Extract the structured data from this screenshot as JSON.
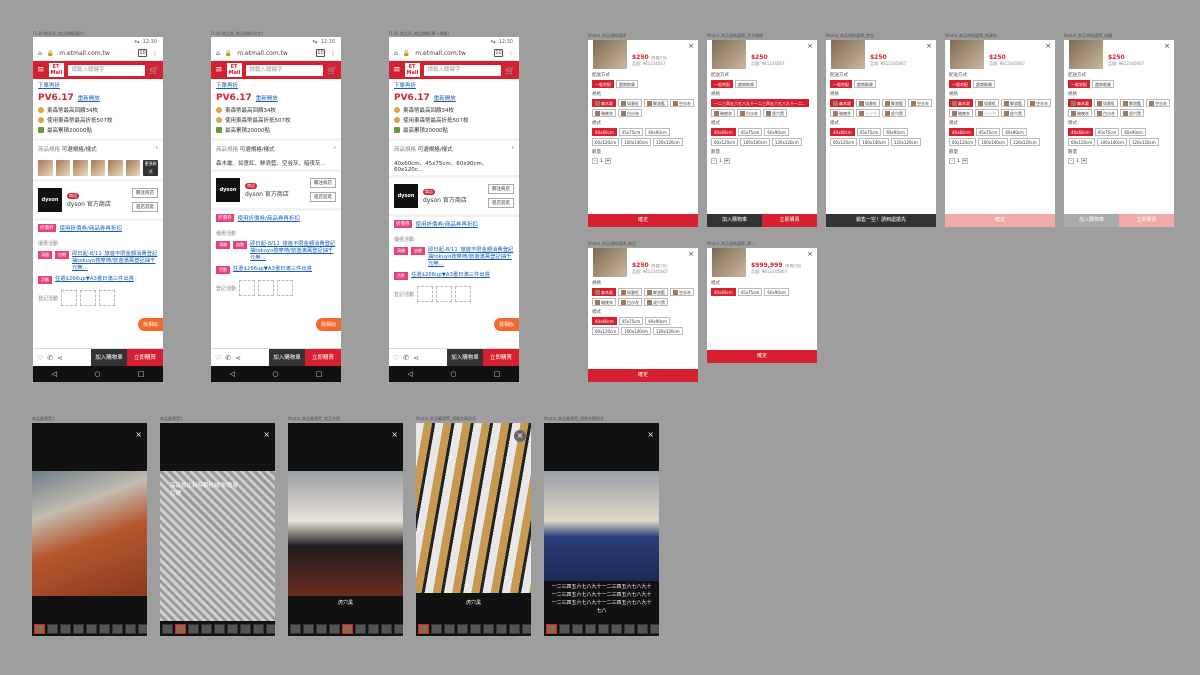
{
  "phones": [
    {
      "caption": "[1-8] 商品頁_商品規格(圖片)",
      "time": "12:30",
      "url": "m.etmall.com.tw",
      "tabs": "10",
      "search": "請輸入關鍵字",
      "logo": "ET Mall",
      "link": "下單再折",
      "pv": "PV6.17",
      "pvlink": "重新開放",
      "row1": "東森幣最高回饋34枚",
      "row2": "使用東森幣最高折抵507枚",
      "row3": "最高累積20000點",
      "spec_label": "商品規格",
      "spec_value": "可選規格/樣式",
      "spec_text": "",
      "more": "更多款式",
      "shop_tag": "商店",
      "shop": "dyson 官方商店",
      "follow": "關注商店",
      "enter": "進店逛逛",
      "promo_tag": "折價券",
      "promo": "使用折價券/商品券再折扣",
      "sec": "優惠活動",
      "e1t": "滿額",
      "e1t2": "加贈",
      "e1": "即日起-8/11_旅遊不限金額消費登記抽tokuyo按摩椅/旅遊滿萬登記抽千元無…",
      "e2t": "活動",
      "e2": "任選$266up▼A3書日滿三件出貨",
      "gift": "登記活動",
      "fab": "找相似",
      "cart": "加入購物車",
      "buy": "立即購買"
    },
    {
      "caption": "[1-8] 商品頁_商品規格(文字)",
      "time": "12:30",
      "url": "m.etmall.com.tw",
      "tabs": "10",
      "search": "請輸入關鍵字",
      "logo": "ET Mall",
      "link": "下單再折",
      "pv": "PV6.17",
      "pvlink": "重新開放",
      "row1": "東森幣最高回饋34枚",
      "row2": "使用東森幣最高折抵507枚",
      "row3": "最高累積20000點",
      "spec_label": "商品規格",
      "spec_value": "可選規格/樣式",
      "spec_text": "森木敢、如意紅、鮮浪藍、空谷灰、暗夜灰...",
      "more": "",
      "shop_tag": "商店",
      "shop": "dyson 官方商店",
      "follow": "關注商店",
      "enter": "進店逛逛",
      "promo_tag": "折價券",
      "promo": "使用折價券/商品券再折扣",
      "sec": "優惠活動",
      "e1t": "滿額",
      "e1t2": "加贈",
      "e1": "即日起-8/11_旅遊不限金額消費登記抽tokuyo按摩椅/旅遊滿萬登記抽千元無…",
      "e2t": "活動",
      "e2": "任選$266up▼A3書日滿三件出貨",
      "gift": "登記活動",
      "fab": "找相似",
      "cart": "加入購物車",
      "buy": "立即購買"
    },
    {
      "caption": "[1-8] 商品頁_商品規格(單一規格)",
      "time": "12:30",
      "url": "m.etmall.com.tw",
      "tabs": "10",
      "search": "請輸入關鍵字",
      "logo": "ET Mall",
      "link": "下單再折",
      "pv": "PV6.17",
      "pvlink": "重新開放",
      "row1": "東森幣最高回饋34枚",
      "row2": "使用東森幣最高折抵507枚",
      "row3": "最高累積20000點",
      "spec_label": "商品規格",
      "spec_value": "可選規格/樣式",
      "spec_text": "40x60cm、45x75cm、60x90cm、60x120c...",
      "more": "",
      "shop_tag": "商店",
      "shop": "dyson 官方商店",
      "follow": "關注商店",
      "enter": "進店逛逛",
      "promo_tag": "折價券",
      "promo": "使用折價券/商品券再折扣",
      "sec": "優惠活動",
      "e1t": "滿額",
      "e1t2": "加贈",
      "e1": "即日起-8/11_旅遊不限金額消費登記抽tokuyo按摩椅/旅遊滿萬登記抽千元無…",
      "e2t": "活動",
      "e2": "任選$266up▼A3書日滿三件出貨",
      "gift": "登記活動",
      "fab": "找相似",
      "cart": "加入購物車",
      "buy": "立即購買"
    }
  ],
  "modals": [
    {
      "caption": "Modal_商品規格選擇",
      "price": "$250",
      "orig": "(售價已折)",
      "code": "品號: 981234567",
      "ship": "配送方式",
      "ship1": "一般宅配",
      "ship2": "超商取貨",
      "l1": "規格",
      "c1": [
        "森木敢",
        "如意紅",
        "鮮浪藍",
        "空谷灰",
        "暗夜灰",
        "白沙灰"
      ],
      "l2": "樣式",
      "c2": [
        "40x60cm",
        "45x75cm",
        "60x90cm",
        "60x120cm",
        "100x140cm",
        "120x120cm"
      ],
      "qty": "數量",
      "qv": "1",
      "f": [
        [
          "確定",
          "rd"
        ]
      ]
    },
    {
      "caption": "Modal_商品規格選擇_文字規格",
      "price": "$250",
      "orig": "",
      "code": "品號: 981234567",
      "ship": "配送方式",
      "ship1": "一般宅配",
      "ship2": "超商取貨",
      "l1": "規格",
      "c1": [
        "一二三四五六七八九十一二三四五六七八九十一二...",
        "暗夜灰",
        "白沙灰",
        "虎穴黑"
      ],
      "l2": "樣式",
      "c2": [
        "40x60cm",
        "45x75cm",
        "60x90cm",
        "60x120cm",
        "100x140cm",
        "120x120cm"
      ],
      "qty": "數量",
      "qv": "1",
      "f": [
        [
          "加入購物車",
          "dk"
        ],
        [
          "立即購買",
          "rd"
        ]
      ]
    },
    {
      "caption": "Modal_商品規格選擇_售完",
      "price": "$250",
      "orig": "",
      "code": "品號: 9812345867",
      "ship": "配送方式",
      "ship1": "一般宅配",
      "ship2": "超商取貨",
      "l1": "規格",
      "c1": [
        "森木敢",
        "如意紅",
        "鮮浪藍",
        "空谷灰",
        "暗夜灰",
        "白沙灰",
        "虎穴黑"
      ],
      "l2": "樣式",
      "c2": [
        "40x60cm",
        "45x75cm",
        "60x90cm",
        "60x120cm",
        "100x140cm",
        "120x120cm"
      ],
      "qty": "",
      "qv": "",
      "f": [
        [
          "銷售一空！請到處搶先",
          "dk"
        ]
      ]
    },
    {
      "caption": "Modal_商品規格選擇_無庫存",
      "price": "$250",
      "orig": "",
      "code": "品號: 9812345667",
      "ship": "配送方式",
      "ship1": "一般宅配",
      "ship2": "超商取貨",
      "l1": "規格",
      "c1": [
        "森木敢",
        "如意紅",
        "鮮浪藍",
        "空谷灰",
        "暗夜灰",
        "白沙灰",
        "虎穴黑"
      ],
      "l2": "樣式",
      "c2": [
        "40x60cm",
        "45x75cm",
        "60x90cm",
        "60x120cm",
        "100x140cm",
        "120x120cm"
      ],
      "qty": "數量",
      "qv": "1",
      "f": [
        [
          "確定",
          "pk"
        ]
      ]
    },
    {
      "caption": "Modal_商品規格選擇_加購",
      "price": "$250",
      "orig": "",
      "code": "品號: 9812345667",
      "ship": "配送方式",
      "ship1": "一般宅配",
      "ship2": "超商取貨",
      "l1": "規格",
      "c1": [
        "森木敢",
        "如意紅",
        "鮮浪藍",
        "空谷灰",
        "暗夜灰",
        "白沙灰",
        "虎穴黑"
      ],
      "l2": "樣式",
      "c2": [
        "40x60cm",
        "45x75cm",
        "60x90cm",
        "60x120cm",
        "100x140cm",
        "120x120cm"
      ],
      "qty": "數量",
      "qv": "1",
      "f": [
        [
          "加入購物車",
          "gy"
        ],
        [
          "立即購買",
          "pk"
        ]
      ]
    },
    {
      "caption": "Modal_商品規格選擇_確定",
      "price": "$250",
      "orig": "(售價已折)",
      "code": "品號: 9812345667",
      "ship": "",
      "ship1": "",
      "ship2": "",
      "l1": "規格",
      "c1": [
        "森木敢",
        "如意紅",
        "鮮浪藍",
        "空谷灰",
        "暗夜灰",
        "白沙灰",
        "虎穴黑"
      ],
      "l2": "樣式",
      "c2": [
        "40x60cm",
        "45x75cm",
        "60x90cm",
        "60x120cm",
        "100x140cm",
        "120x120cm"
      ],
      "qty": "",
      "qv": "",
      "f": [
        [
          "確定",
          "rd"
        ]
      ]
    },
    {
      "caption": "Modal_商品規格選擇_單一",
      "price": "$999,999",
      "orig": "(售價已折)",
      "code": "品號: 9812345667",
      "ship": "",
      "ship1": "",
      "ship2": "",
      "l1": "樣式",
      "c1": [
        "40x60cm",
        "45x75cm",
        "60x90cm"
      ],
      "l2": "",
      "c2": [],
      "qty": "",
      "qv": "",
      "f": [
        [
          "確定",
          "rd"
        ]
      ]
    }
  ],
  "galleries": [
    {
      "caption": "商品圖瀏覽1",
      "text": "",
      "label": ""
    },
    {
      "caption": "商品圖瀏覽2",
      "text": "高品質比利時顆粒絨 耐磨易打理",
      "label": ""
    },
    {
      "caption": "Modal_商品圖瀏覽_商品名稱",
      "text": "",
      "label": "虎穴黑"
    },
    {
      "caption": "Modal_商品圖瀏覽_規格名稱過長",
      "text": "",
      "label": "虎穴黑"
    },
    {
      "caption": "Modal_商品圖瀏覽_規格名稱過長",
      "text": "",
      "label": "一二三四五六七八九十一二三四五六七八九十一二三四五六七八九十一二三四五六七八九十一二三四五六七八九十一二三四五六七八九十七八"
    }
  ]
}
